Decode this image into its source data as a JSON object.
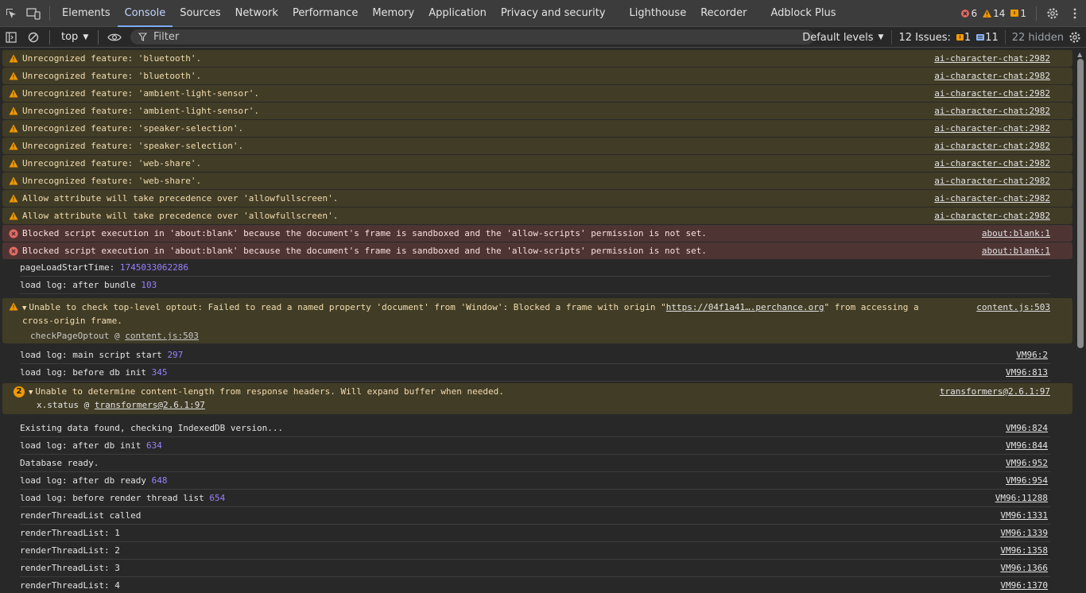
{
  "tabs": [
    "Elements",
    "Console",
    "Sources",
    "Network",
    "Performance",
    "Memory",
    "Application",
    "Privacy and security",
    "Lighthouse",
    "Recorder",
    "Adblock Plus"
  ],
  "active_tab": "Console",
  "counts": {
    "errors": "6",
    "warnings": "14",
    "issues": "1"
  },
  "toolbar": {
    "context": "top",
    "filter_placeholder": "Filter",
    "levels": "Default levels",
    "issues_label": "12 Issues:",
    "issues_a": "1",
    "issues_b": "11",
    "hidden": "22 hidden"
  },
  "messages": [
    {
      "type": "warn",
      "text": "Unrecognized feature: 'bluetooth'.",
      "src": "ai-character-chat:2982"
    },
    {
      "type": "warn",
      "text": "Unrecognized feature: 'bluetooth'.",
      "src": "ai-character-chat:2982"
    },
    {
      "type": "warn",
      "text": "Unrecognized feature: 'ambient-light-sensor'.",
      "src": "ai-character-chat:2982"
    },
    {
      "type": "warn",
      "text": "Unrecognized feature: 'ambient-light-sensor'.",
      "src": "ai-character-chat:2982"
    },
    {
      "type": "warn",
      "text": "Unrecognized feature: 'speaker-selection'.",
      "src": "ai-character-chat:2982"
    },
    {
      "type": "warn",
      "text": "Unrecognized feature: 'speaker-selection'.",
      "src": "ai-character-chat:2982"
    },
    {
      "type": "warn",
      "text": "Unrecognized feature: 'web-share'.",
      "src": "ai-character-chat:2982"
    },
    {
      "type": "warn",
      "text": "Unrecognized feature: 'web-share'.",
      "src": "ai-character-chat:2982"
    },
    {
      "type": "warn",
      "text": "Allow attribute will take precedence over 'allowfullscreen'.",
      "src": "ai-character-chat:2982"
    },
    {
      "type": "warn",
      "text": "Allow attribute will take precedence over 'allowfullscreen'.",
      "src": "ai-character-chat:2982"
    },
    {
      "type": "err",
      "text": "Blocked script execution in 'about:blank' because the document's frame is sandboxed and the 'allow-scripts' permission is not set.",
      "src": "about:blank:1"
    },
    {
      "type": "err",
      "text": "Blocked script execution in 'about:blank' because the document's frame is sandboxed and the 'allow-scripts' permission is not set.",
      "src": "about:blank:1"
    }
  ],
  "log1": {
    "text": "pageLoadStartTime:",
    "num": "1745033062286"
  },
  "log2": {
    "text": "load log: after bundle",
    "num": "103"
  },
  "optout": {
    "pre": "Unable to check top-level optout: Failed to read a named property 'document' from 'Window': Blocked a frame with origin \"",
    "link": "https://04f1a41….perchance.org",
    "post": "\" from accessing a cross-origin frame.",
    "src": "content.js:503",
    "stack_fn": "checkPageOptout @",
    "stack_link": "content.js:503"
  },
  "log3": {
    "text": "load log: main script start",
    "num": "297",
    "src": "VM96:2"
  },
  "log4": {
    "text": "load log: before db init",
    "num": "345",
    "src": "VM96:813"
  },
  "buffer": {
    "badge": "2",
    "text": "Unable to determine content-length from response headers. Will expand buffer when needed.",
    "src": "transformers@2.6.1:97",
    "stack_fn": "x.status @",
    "stack_link": "transformers@2.6.1:97"
  },
  "logs": [
    {
      "text": "Existing data found, checking IndexedDB version...",
      "num": "",
      "src": "VM96:824"
    },
    {
      "text": "load log: after db init",
      "num": "634",
      "src": "VM96:844"
    },
    {
      "text": "Database ready.",
      "num": "",
      "src": "VM96:952"
    },
    {
      "text": "load log: after db ready",
      "num": "648",
      "src": "VM96:954"
    },
    {
      "text": "load log: before render thread list",
      "num": "654",
      "src": "VM96:11288"
    },
    {
      "text": "renderThreadList called",
      "num": "",
      "src": "VM96:1331"
    },
    {
      "text": "renderThreadList: 1",
      "num": "",
      "src": "VM96:1339"
    },
    {
      "text": "renderThreadList: 2",
      "num": "",
      "src": "VM96:1358"
    },
    {
      "text": "renderThreadList: 3",
      "num": "",
      "src": "VM96:1366"
    },
    {
      "text": "renderThreadList: 4",
      "num": "",
      "src": "VM96:1370"
    }
  ]
}
